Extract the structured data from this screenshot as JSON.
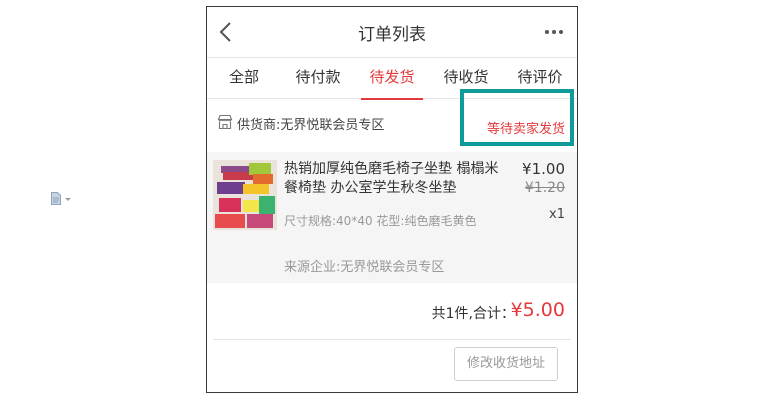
{
  "navbar": {
    "title": "订单列表",
    "back_icon": "chevron-left-icon",
    "more_icon": "more-dots-icon"
  },
  "tabs": [
    {
      "label": "全部",
      "active": false
    },
    {
      "label": "待付款",
      "active": false
    },
    {
      "label": "待发货",
      "active": true
    },
    {
      "label": "待收货",
      "active": false
    },
    {
      "label": "待评价",
      "active": false
    }
  ],
  "order": {
    "supplier": "供货商:无界悦联会员专区",
    "status": "等待卖家发货",
    "product": {
      "name": "热销加厚纯色磨毛椅子坐垫 榻榻米餐椅垫 办公室学生秋冬坐垫",
      "price": "¥1.00",
      "original_price": "¥1.20",
      "spec": "尺寸规格:40*40 花型:纯色磨毛黄色",
      "quantity": "x1",
      "source": "来源企业:无界悦联会员专区"
    },
    "total_label": "共1件,合计：",
    "total_amount": "¥5.00",
    "address_button": "修改收货地址"
  },
  "colors": {
    "accent": "#e4393c",
    "highlight": "#119a9a"
  }
}
